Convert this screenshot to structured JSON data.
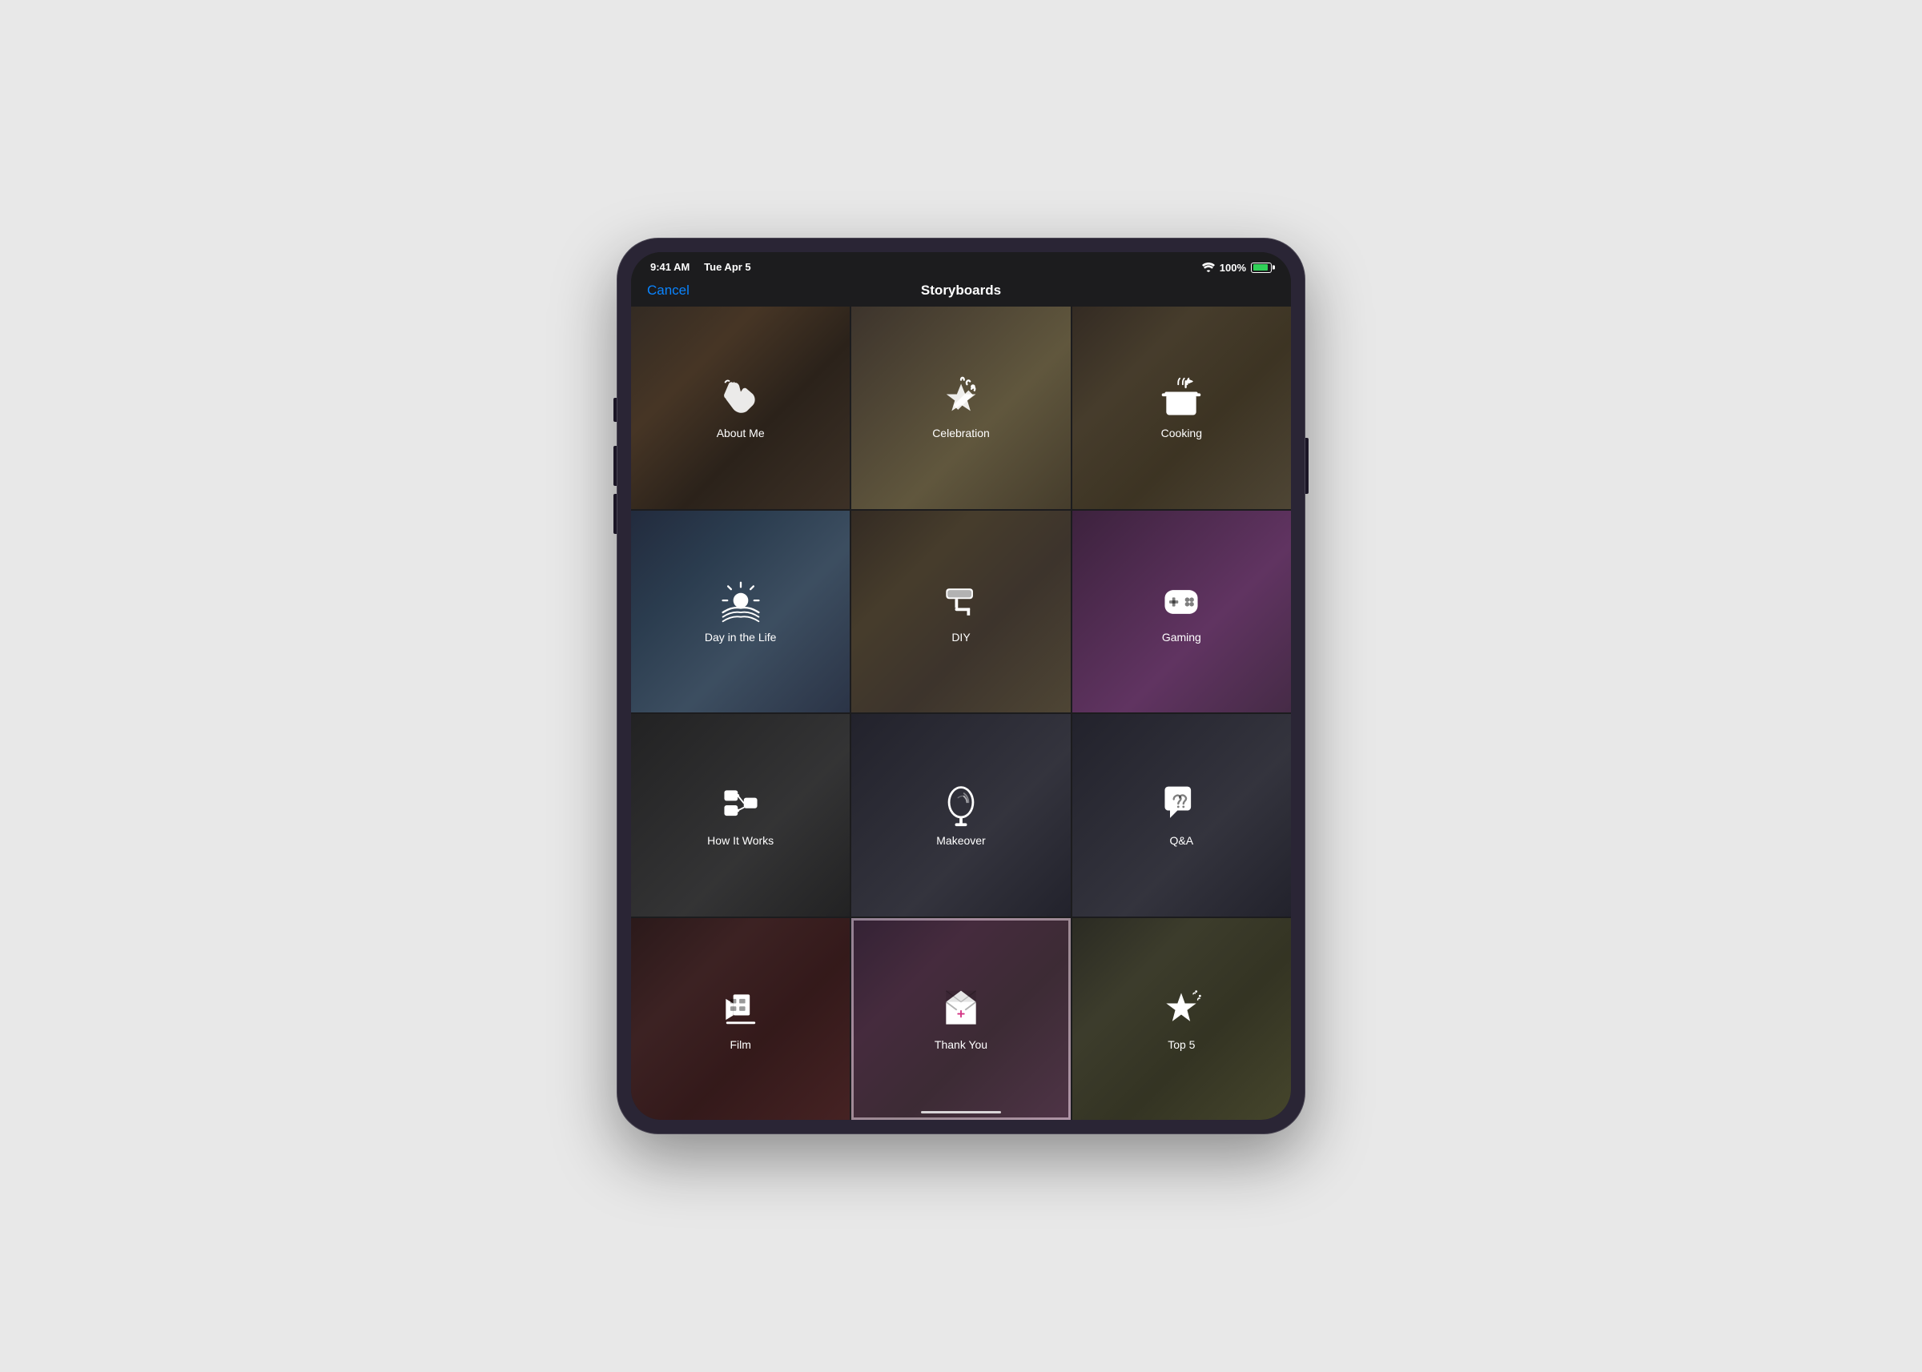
{
  "device": {
    "time": "9:41 AM",
    "date": "Tue Apr 5",
    "battery_pct": "100%",
    "wifi": true
  },
  "nav": {
    "cancel_label": "Cancel",
    "title": "Storyboards"
  },
  "grid": {
    "items": [
      {
        "id": "about-me",
        "label": "About Me",
        "icon": "wave",
        "bg_class": "bg-about-me",
        "selected": false
      },
      {
        "id": "celebration",
        "label": "Celebration",
        "icon": "party",
        "bg_class": "bg-celebration",
        "selected": false
      },
      {
        "id": "cooking",
        "label": "Cooking",
        "icon": "pot",
        "bg_class": "bg-cooking",
        "selected": false
      },
      {
        "id": "day-in-life",
        "label": "Day in the Life",
        "icon": "sunrise",
        "bg_class": "bg-day-in-life",
        "selected": false
      },
      {
        "id": "diy",
        "label": "DIY",
        "icon": "roller",
        "bg_class": "bg-diy",
        "selected": false
      },
      {
        "id": "gaming",
        "label": "Gaming",
        "icon": "gamepad",
        "bg_class": "bg-gaming",
        "selected": false
      },
      {
        "id": "how-it-works",
        "label": "How It Works",
        "icon": "workflow",
        "bg_class": "bg-how-it-works",
        "selected": false
      },
      {
        "id": "makeover",
        "label": "Makeover",
        "icon": "mirror",
        "bg_class": "bg-makeover",
        "selected": false
      },
      {
        "id": "qa",
        "label": "Q&A",
        "icon": "qa",
        "bg_class": "bg-qa",
        "selected": false
      },
      {
        "id": "film",
        "label": "Film",
        "icon": "film",
        "bg_class": "bg-film",
        "selected": false
      },
      {
        "id": "thank-you",
        "label": "Thank You",
        "icon": "letter",
        "bg_class": "bg-thank-you",
        "selected": true
      },
      {
        "id": "top5",
        "label": "Top 5",
        "icon": "star",
        "bg_class": "bg-top5",
        "selected": false
      }
    ]
  }
}
